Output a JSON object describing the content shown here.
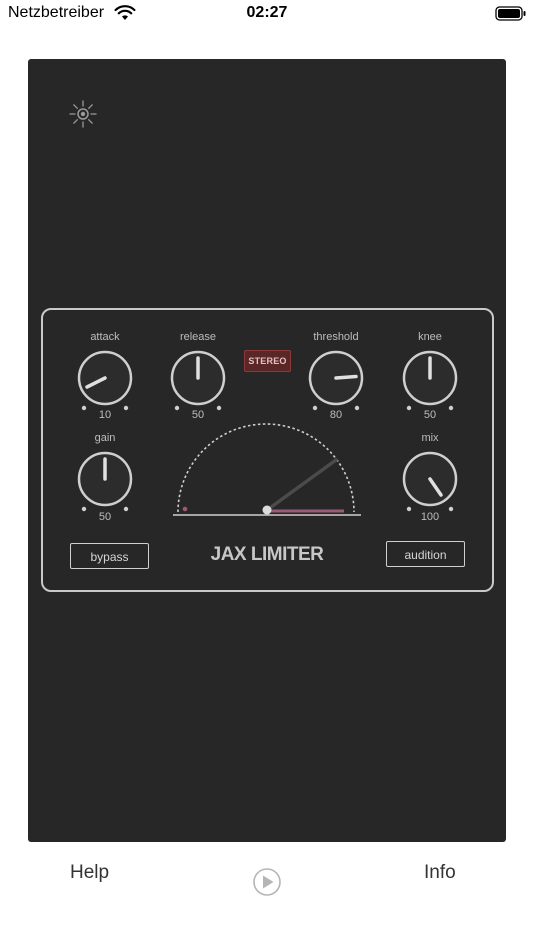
{
  "status_bar": {
    "carrier": "Netzbetreiber",
    "time": "02:27"
  },
  "plugin": {
    "title": "JAX LIMITER",
    "stereo_badge": "STEREO",
    "knobs": {
      "attack": {
        "label": "attack",
        "value": "10"
      },
      "release": {
        "label": "release",
        "value": "50"
      },
      "threshold": {
        "label": "threshold",
        "value": "80"
      },
      "knee": {
        "label": "knee",
        "value": "50"
      },
      "gain": {
        "label": "gain",
        "value": "50"
      },
      "mix": {
        "label": "mix",
        "value": "100"
      }
    },
    "buttons": {
      "bypass": "bypass",
      "audition": "audition"
    }
  },
  "toolbar": {
    "help": "Help",
    "info": "Info"
  },
  "icons": {
    "settings": "sun-icon",
    "play": "play-circle-icon",
    "wifi": "wifi-icon",
    "battery": "battery-icon"
  },
  "colors": {
    "panel_background": "#272727",
    "stereo_badge": "#5a2626",
    "meter_accent": "#9b5a78"
  }
}
